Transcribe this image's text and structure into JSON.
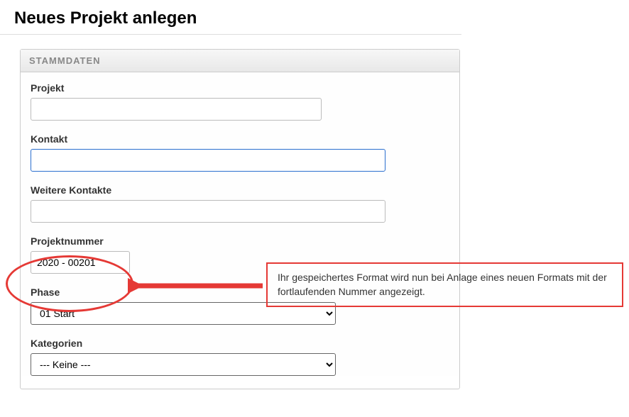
{
  "page": {
    "title": "Neues Projekt anlegen"
  },
  "panel": {
    "header": "STAMMDATEN"
  },
  "fields": {
    "projekt": {
      "label": "Projekt",
      "value": ""
    },
    "kontakt": {
      "label": "Kontakt",
      "value": ""
    },
    "weitere_kontakte": {
      "label": "Weitere Kontakte",
      "value": ""
    },
    "projektnummer": {
      "label": "Projektnummer",
      "value": "2020 - 00201"
    },
    "phase": {
      "label": "Phase",
      "selected": "01 Start"
    },
    "kategorien": {
      "label": "Kategorien",
      "selected": "--- Keine ---"
    }
  },
  "annotation": {
    "text": "Ihr gespeichertes Format wird nun bei Anlage eines neuen Formats mit der fortlaufenden Nummer angezeigt."
  }
}
